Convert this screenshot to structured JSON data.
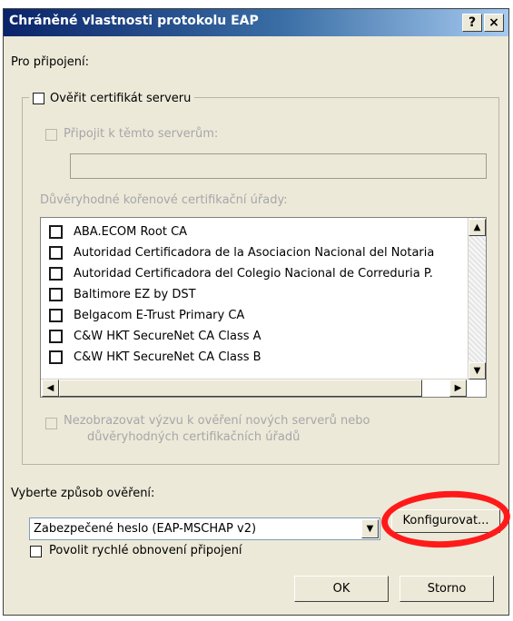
{
  "window": {
    "title": "Chráněné vlastnosti protokolu EAP",
    "help_label": "?",
    "close_label": "×"
  },
  "connect": {
    "section_label": "Pro připojení:",
    "verify_cert_label": "Ověřit certifikát serveru",
    "connect_servers_label": "Připojit k těmto serverům:",
    "servers_value": "",
    "trusted_ca_label": "Důvěryhodné kořenové certifikační úřady:",
    "ca_list": [
      {
        "label": "ABA.ECOM Root CA",
        "checked": false
      },
      {
        "label": "Autoridad Certificadora de la Asociacion Nacional del Notaria",
        "checked": false
      },
      {
        "label": "Autoridad Certificadora del Colegio Nacional de Correduria P.",
        "checked": false
      },
      {
        "label": "Baltimore EZ by DST",
        "checked": false
      },
      {
        "label": "Belgacom E-Trust Primary CA",
        "checked": false
      },
      {
        "label": "C&W HKT SecureNet CA Class A",
        "checked": false
      },
      {
        "label": "C&W HKT SecureNet CA Class B",
        "checked": false
      }
    ],
    "no_prompt_label_line1": "Nezobrazovat výzvu k ověření nových serverů nebo",
    "no_prompt_label_line2": "důvěryhodných certifikačních úřadů"
  },
  "auth": {
    "method_label": "Vyberte způsob ověření:",
    "method_value": "Zabezpečené heslo (EAP-MSCHAP v2)",
    "configure_label": "Konfigurovat...",
    "fast_reconnect_label": "Povolit rychlé obnovení připojení"
  },
  "buttons": {
    "ok": "OK",
    "cancel": "Storno"
  },
  "colors": {
    "title_gradient_start": "#0a246a",
    "dialog_bg": "#ece9d8",
    "annotation": "#ff1a1a"
  }
}
